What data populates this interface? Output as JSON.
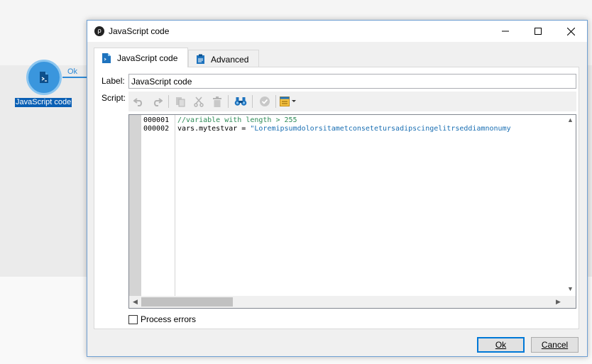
{
  "workflow": {
    "node_label": "JavaScript code",
    "transition_label": "Ok"
  },
  "dialog": {
    "title": "JavaScript code",
    "tabs": [
      {
        "label": "JavaScript code",
        "icon": "script-icon",
        "active": true
      },
      {
        "label": "Advanced",
        "icon": "clipboard-icon",
        "active": false
      }
    ],
    "label_caption": "Label:",
    "label_value": "JavaScript code",
    "script_caption": "Script:",
    "toolbar_icons": [
      "undo-icon",
      "redo-icon",
      "paste-icon",
      "cut-icon",
      "delete-icon",
      "find-icon",
      "validate-icon",
      "insert-menu-icon"
    ],
    "editor": {
      "lines": [
        {
          "number": "000001",
          "text": "//variable with length > 255",
          "kind": "comment"
        },
        {
          "number": "000002",
          "prefix": "vars.mytestvar = ",
          "string": "\"Loremipsumdolorsitametconseteturs­adipscingelitrseddiamnonumy",
          "kind": "code"
        }
      ]
    },
    "process_errors_label": "Process errors",
    "process_errors_checked": false,
    "ok_label": "Ok",
    "cancel_label": "Cancel"
  },
  "colors": {
    "accent": "#3a96dd",
    "selection": "#0a5fb4",
    "comment": "#2e8b57",
    "string": "#1a6fb3"
  }
}
